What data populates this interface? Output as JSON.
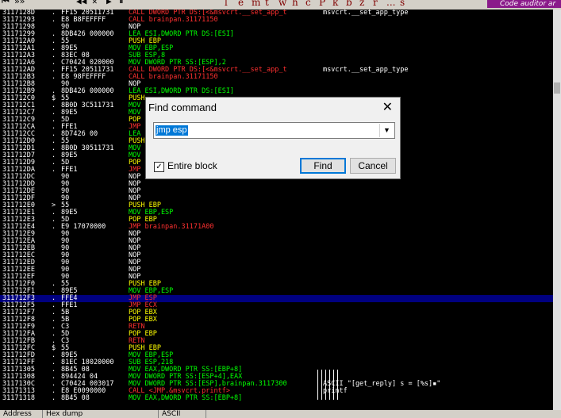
{
  "toolbar": {
    "buttons": [
      "⏮",
      "»»",
      "◀◀",
      "✕",
      "▶",
      "⏸"
    ],
    "letters": [
      "l",
      "e",
      "m",
      "t",
      "w",
      "h",
      "c",
      "P",
      "k",
      "b",
      "z",
      "r",
      "...",
      "s"
    ],
    "auditor_label": "Code auditor ar"
  },
  "disasm": {
    "rows": [
      {
        "addr": "3117128D",
        "mark": ".",
        "hex": "FF15 20511731",
        "instr": "CALL DWORD PTR DS:[<&msvcrt.__set_app_t",
        "cls": "mnem-call",
        "comment": "msvcrt.__set_app_type"
      },
      {
        "addr": "31171293",
        "mark": ".",
        "hex": "E8 B8FEFFFF",
        "instr": "CALL brainpan.31171150",
        "cls": "mnem-call",
        "comment": ""
      },
      {
        "addr": "31171298",
        "mark": "",
        "hex": "90",
        "instr": "NOP",
        "cls": "mnem-nop",
        "comment": ""
      },
      {
        "addr": "31171299",
        "mark": ".",
        "hex": "8DB426 000000",
        "instr": "LEA ESI,DWORD PTR DS:[ESI]",
        "cls": "mnem-mov",
        "comment": ""
      },
      {
        "addr": "311712A0",
        "mark": ".",
        "hex": "55",
        "instr": "PUSH EBP",
        "cls": "mnem-pushpop",
        "comment": ""
      },
      {
        "addr": "311712A1",
        "mark": ".",
        "hex": "89E5",
        "instr": "MOV EBP,ESP",
        "cls": "mnem-mov",
        "comment": ""
      },
      {
        "addr": "311712A3",
        "mark": ".",
        "hex": "83EC 08",
        "instr": "SUB ESP,8",
        "cls": "mnem-mov",
        "comment": ""
      },
      {
        "addr": "311712A6",
        "mark": ".",
        "hex": "C70424 020000",
        "instr": "MOV DWORD PTR SS:[ESP],2",
        "cls": "mnem-mov",
        "comment": ""
      },
      {
        "addr": "311712AD",
        "mark": ".",
        "hex": "FF15 20511731",
        "instr": "CALL DWORD PTR DS:[<&msvcrt.__set_app_t",
        "cls": "mnem-call",
        "comment": "msvcrt.__set_app_type"
      },
      {
        "addr": "311712B3",
        "mark": ".",
        "hex": "E8 98FEFFFF",
        "instr": "CALL brainpan.31171150",
        "cls": "mnem-call",
        "comment": ""
      },
      {
        "addr": "311712B8",
        "mark": "",
        "hex": "90",
        "instr": "NOP",
        "cls": "mnem-nop",
        "comment": ""
      },
      {
        "addr": "311712B9",
        "mark": ".",
        "hex": "8DB426 000000",
        "instr": "LEA ESI,DWORD PTR DS:[ESI]",
        "cls": "mnem-mov",
        "comment": ""
      },
      {
        "addr": "311712C0",
        "mark": "$",
        "hex": "55",
        "instr": "PUSH",
        "cls": "mnem-pushpop",
        "comment": ""
      },
      {
        "addr": "311712C1",
        "mark": ".",
        "hex": "8B0D 3C511731",
        "instr": "MOV",
        "cls": "mnem-mov",
        "comment": ""
      },
      {
        "addr": "311712C7",
        "mark": ".",
        "hex": "89E5",
        "instr": "MOV",
        "cls": "mnem-mov",
        "comment": ""
      },
      {
        "addr": "311712C9",
        "mark": ".",
        "hex": "5D",
        "instr": "POP",
        "cls": "mnem-pushpop",
        "comment": ""
      },
      {
        "addr": "311712CA",
        "mark": ".",
        "hex": "FFE1",
        "instr": "JMP",
        "cls": "mnem-jmp",
        "comment": ""
      },
      {
        "addr": "311712CC",
        "mark": ".",
        "hex": "8D7426 00",
        "instr": "LEA",
        "cls": "mnem-mov",
        "comment": ""
      },
      {
        "addr": "311712D0",
        "mark": ".",
        "hex": "55",
        "instr": "PUSH",
        "cls": "mnem-pushpop",
        "comment": ""
      },
      {
        "addr": "311712D1",
        "mark": ".",
        "hex": "8B0D 30511731",
        "instr": "MOV",
        "cls": "mnem-mov",
        "comment": ""
      },
      {
        "addr": "311712D7",
        "mark": ".",
        "hex": "89E5",
        "instr": "MOV",
        "cls": "mnem-mov",
        "comment": ""
      },
      {
        "addr": "311712D9",
        "mark": ".",
        "hex": "5D",
        "instr": "POP",
        "cls": "mnem-pushpop",
        "comment": ""
      },
      {
        "addr": "311712DA",
        "mark": ".",
        "hex": "FFE1",
        "instr": "JMP",
        "cls": "mnem-jmp",
        "comment": ""
      },
      {
        "addr": "311712DC",
        "mark": "",
        "hex": "90",
        "instr": "NOP",
        "cls": "mnem-nop",
        "comment": ""
      },
      {
        "addr": "311712DD",
        "mark": "",
        "hex": "90",
        "instr": "NOP",
        "cls": "mnem-nop",
        "comment": ""
      },
      {
        "addr": "311712DE",
        "mark": "",
        "hex": "90",
        "instr": "NOP",
        "cls": "mnem-nop",
        "comment": ""
      },
      {
        "addr": "311712DF",
        "mark": "",
        "hex": "90",
        "instr": "NOP",
        "cls": "mnem-nop",
        "comment": ""
      },
      {
        "addr": "311712E0",
        "mark": ">",
        "hex": "55",
        "instr": "PUSH EBP",
        "cls": "mnem-pushpop",
        "comment": ""
      },
      {
        "addr": "311712E1",
        "mark": ".",
        "hex": "89E5",
        "instr": "MOV EBP,ESP",
        "cls": "mnem-mov",
        "comment": ""
      },
      {
        "addr": "311712E3",
        "mark": ".",
        "hex": "5D",
        "instr": "POP EBP",
        "cls": "mnem-pushpop",
        "comment": ""
      },
      {
        "addr": "311712E4",
        "mark": ".",
        "hex": "E9 17070000",
        "instr": "JMP brainpan.31171A00",
        "cls": "mnem-jmp",
        "comment": ""
      },
      {
        "addr": "311712E9",
        "mark": "",
        "hex": "90",
        "instr": "NOP",
        "cls": "mnem-nop",
        "comment": ""
      },
      {
        "addr": "311712EA",
        "mark": "",
        "hex": "90",
        "instr": "NOP",
        "cls": "mnem-nop",
        "comment": ""
      },
      {
        "addr": "311712EB",
        "mark": "",
        "hex": "90",
        "instr": "NOP",
        "cls": "mnem-nop",
        "comment": ""
      },
      {
        "addr": "311712EC",
        "mark": "",
        "hex": "90",
        "instr": "NOP",
        "cls": "mnem-nop",
        "comment": ""
      },
      {
        "addr": "311712ED",
        "mark": "",
        "hex": "90",
        "instr": "NOP",
        "cls": "mnem-nop",
        "comment": ""
      },
      {
        "addr": "311712EE",
        "mark": "",
        "hex": "90",
        "instr": "NOP",
        "cls": "mnem-nop",
        "comment": ""
      },
      {
        "addr": "311712EF",
        "mark": "",
        "hex": "90",
        "instr": "NOP",
        "cls": "mnem-nop",
        "comment": ""
      },
      {
        "addr": "311712F0",
        "mark": ".",
        "hex": "55",
        "instr": "PUSH EBP",
        "cls": "mnem-pushpop",
        "comment": ""
      },
      {
        "addr": "311712F1",
        "mark": ".",
        "hex": "89E5",
        "instr": "MOV EBP,ESP",
        "cls": "mnem-mov",
        "comment": ""
      },
      {
        "addr": "311712F3",
        "mark": ".",
        "hex": "FFE4",
        "instr": "JMP ESP",
        "cls": "mnem-jmp",
        "comment": "",
        "selected": true
      },
      {
        "addr": "311712F5",
        "mark": ".",
        "hex": "FFE1",
        "instr": "JMP ECX",
        "cls": "mnem-jmp",
        "comment": ""
      },
      {
        "addr": "311712F7",
        "mark": ".",
        "hex": "5B",
        "instr": "POP EBX",
        "cls": "mnem-pushpop",
        "comment": ""
      },
      {
        "addr": "311712F8",
        "mark": ".",
        "hex": "5B",
        "instr": "POP EBX",
        "cls": "mnem-pushpop",
        "comment": ""
      },
      {
        "addr": "311712F9",
        "mark": ".",
        "hex": "C3",
        "instr": "RETN",
        "cls": "mnem-call",
        "comment": ""
      },
      {
        "addr": "311712FA",
        "mark": ".",
        "hex": "5D",
        "instr": "POP EBP",
        "cls": "mnem-pushpop",
        "comment": ""
      },
      {
        "addr": "311712FB",
        "mark": ".",
        "hex": "C3",
        "instr": "RETN",
        "cls": "mnem-call",
        "comment": ""
      },
      {
        "addr": "311712FC",
        "mark": "$",
        "hex": "55",
        "instr": "PUSH EBP",
        "cls": "mnem-pushpop",
        "comment": ""
      },
      {
        "addr": "311712FD",
        "mark": ".",
        "hex": "89E5",
        "instr": "MOV EBP,ESP",
        "cls": "mnem-mov",
        "comment": ""
      },
      {
        "addr": "311712FF",
        "mark": ".",
        "hex": "81EC 18020000",
        "instr": "SUB ESP,218",
        "cls": "mnem-mov",
        "comment": ""
      },
      {
        "addr": "31171305",
        "mark": ".",
        "hex": "8B45 08",
        "instr": "MOV EAX,DWORD PTR SS:[EBP+8]",
        "cls": "mnem-mov",
        "comment": ""
      },
      {
        "addr": "31171308",
        "mark": ".",
        "hex": "894424 04",
        "instr": "MOV DWORD PTR SS:[ESP+4],EAX",
        "cls": "mnem-mov",
        "comment": ""
      },
      {
        "addr": "3117130C",
        "mark": ".",
        "hex": "C70424 003017",
        "instr": "MOV DWORD PTR SS:[ESP],brainpan.3117300",
        "cls": "mnem-mov",
        "comment": "ASCII \"[get_reply] s = [%s]▪\""
      },
      {
        "addr": "31171313",
        "mark": ".",
        "hex": "E8 E0090000",
        "instr": "CALL <JMP.&msvcrt.printf>",
        "cls": "mnem-call",
        "comment": "printf"
      },
      {
        "addr": "31171318",
        "mark": ".",
        "hex": "8B45 08",
        "instr": "MOV EAX,DWORD PTR SS:[EBP+8]",
        "cls": "mnem-mov",
        "comment": ""
      }
    ]
  },
  "statusbar": {
    "address": "Address",
    "hexdump": "Hex dump",
    "ascii": "ASCII"
  },
  "find_dialog": {
    "title": "Find command",
    "close_glyph": "✕",
    "search_value": "jmp esp",
    "dropdown_glyph": "▼",
    "entire_block_checked": true,
    "check_glyph": "✓",
    "entire_block_label": "Entire block",
    "find_label": "Find",
    "cancel_label": "Cancel"
  }
}
